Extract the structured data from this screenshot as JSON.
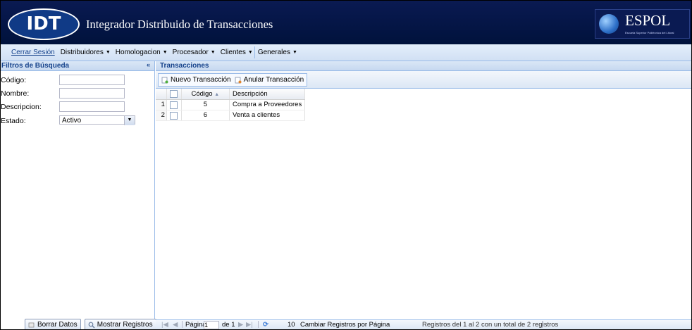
{
  "header": {
    "logo_text": "IDT",
    "title": "Integrador Distribuido de Transacciones",
    "partner_name": "ESPOL",
    "partner_subtitle": "Escuela Superior Politécnica del Litoral"
  },
  "menu": {
    "logout": "Cerrar Sesión",
    "items": [
      {
        "label": "Distribuidores"
      },
      {
        "label": "Homologacion"
      },
      {
        "label": "Procesador"
      },
      {
        "label": "Clientes"
      },
      {
        "label": "Generales"
      }
    ]
  },
  "filters": {
    "title": "Filtros de Búsqueda",
    "collapse_icon": "«",
    "fields": {
      "codigo": {
        "label": "Código:",
        "value": ""
      },
      "nombre": {
        "label": "Nombre:",
        "value": ""
      },
      "descripcion": {
        "label": "Descripcion:",
        "value": ""
      },
      "estado": {
        "label": "Estado:",
        "value": "Activo"
      }
    },
    "buttons": {
      "clear": "Borrar Datos",
      "show": "Mostrar Registros"
    }
  },
  "transactions": {
    "title": "Transacciones",
    "toolbar": {
      "new": "Nuevo Transacción",
      "cancel": "Anular Transacción"
    },
    "grid": {
      "columns": {
        "codigo": "Código",
        "descripcion": "Descripción"
      },
      "rows": [
        {
          "num": "1",
          "codigo": "5",
          "descripcion": "Compra a Proveedores"
        },
        {
          "num": "2",
          "codigo": "6",
          "descripcion": "Venta a clientes"
        }
      ]
    },
    "pager": {
      "page_label": "Página",
      "page_value": "1",
      "of_label": "de 1",
      "page_size": "10",
      "page_size_label": "Cambiar Registros por Página",
      "summary": "Registros del 1 al 2 con un total de 2 registros"
    }
  },
  "colors": {
    "header_bg": "#0a1a52",
    "panel_title": "#15428b",
    "panel_border": "#99bbe8"
  }
}
